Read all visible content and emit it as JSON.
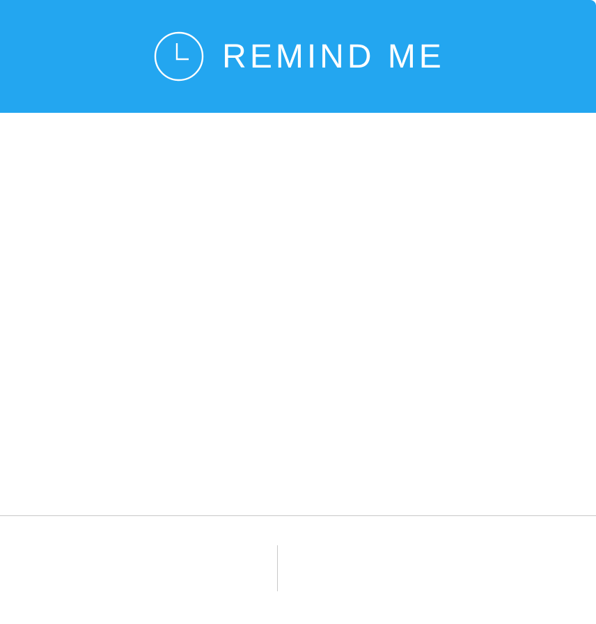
{
  "header": {
    "title": "REMIND ME",
    "icon": "clock-icon",
    "background_color": "#23A6F0",
    "text_color": "#FFFFFF"
  },
  "footer": {
    "divider_color": "#C8C8C8"
  }
}
